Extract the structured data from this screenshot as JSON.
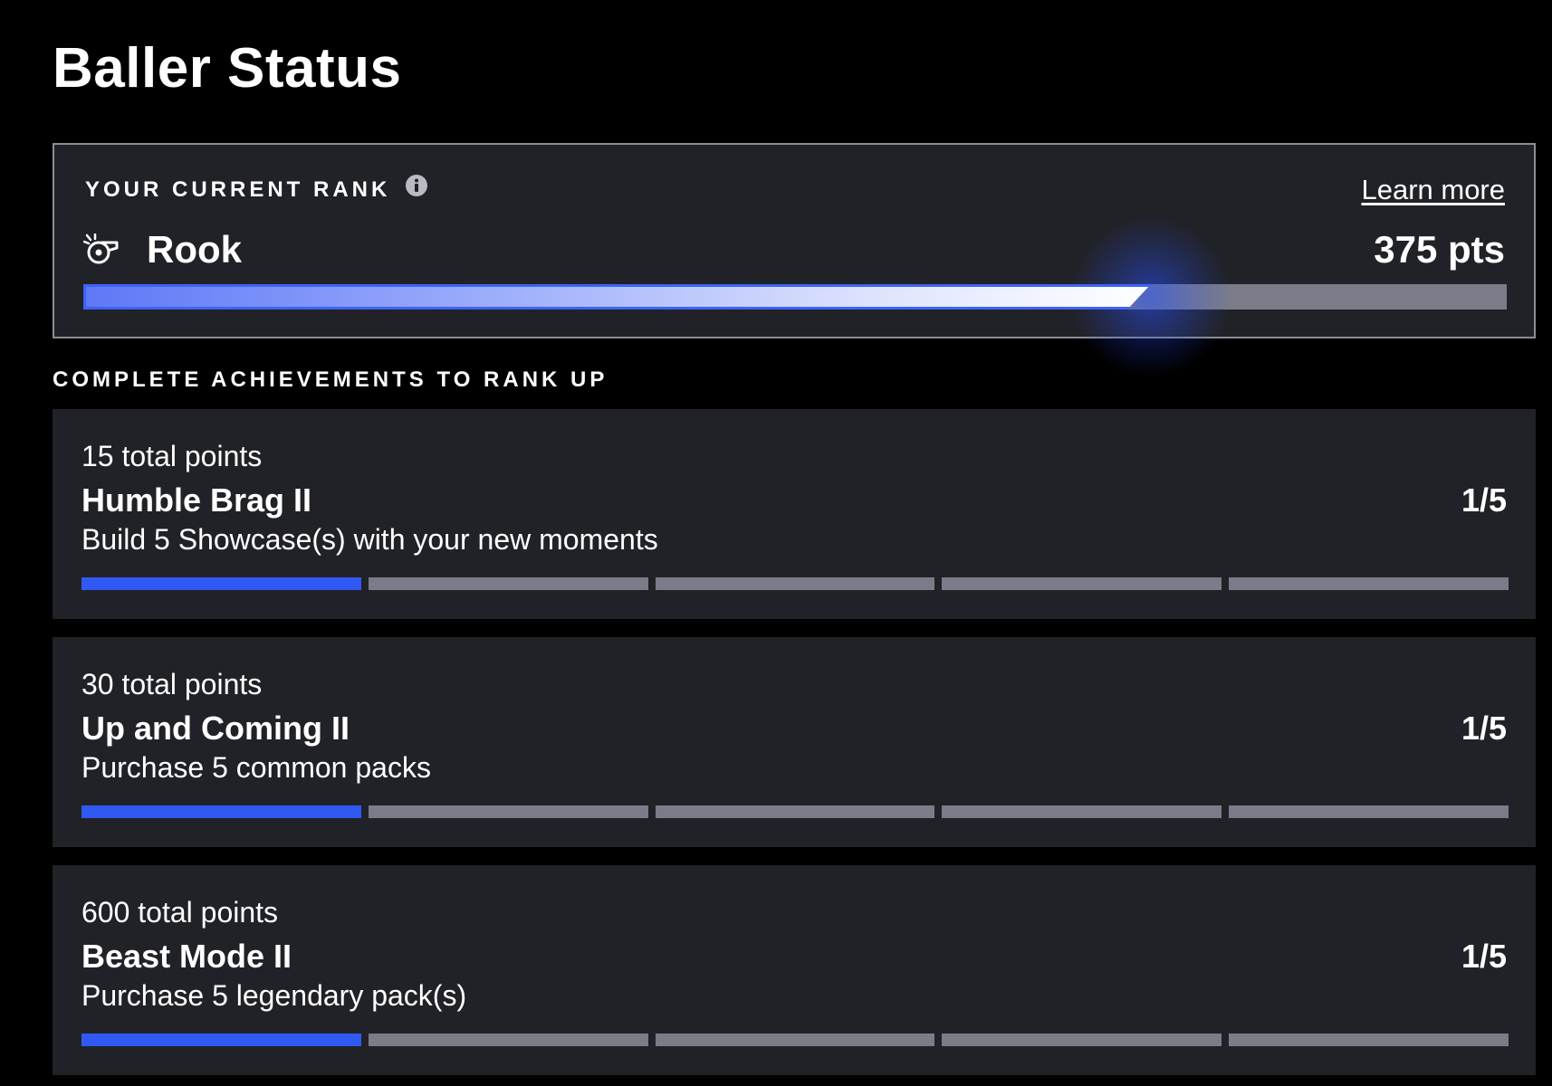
{
  "page": {
    "title": "Baller Status"
  },
  "rank_card": {
    "label": "YOUR CURRENT RANK",
    "info_icon": "info-icon",
    "learn_more": "Learn more",
    "rank_icon": "whistle-icon",
    "rank_name": "Rook",
    "points": "375 pts",
    "progress_fraction": 0.75
  },
  "achievements_section": {
    "title": "COMPLETE ACHIEVEMENTS TO RANK UP"
  },
  "achievements": [
    {
      "points_label": "15 total points",
      "title": "Humble Brag II",
      "description": "Build 5 Showcase(s) with your new moments",
      "progress_text": "1/5",
      "completed": 1,
      "total": 5
    },
    {
      "points_label": "30 total points",
      "title": "Up and Coming II",
      "description": "Purchase 5 common packs",
      "progress_text": "1/5",
      "completed": 1,
      "total": 5
    },
    {
      "points_label": "600 total points",
      "title": "Beast Mode II",
      "description": "Purchase 5 legendary pack(s)",
      "progress_text": "1/5",
      "completed": 1,
      "total": 5
    }
  ],
  "colors": {
    "background": "#000000",
    "card": "#212227",
    "accent": "#3059f4",
    "track": "#7a7c89",
    "text": "#ffffff"
  }
}
